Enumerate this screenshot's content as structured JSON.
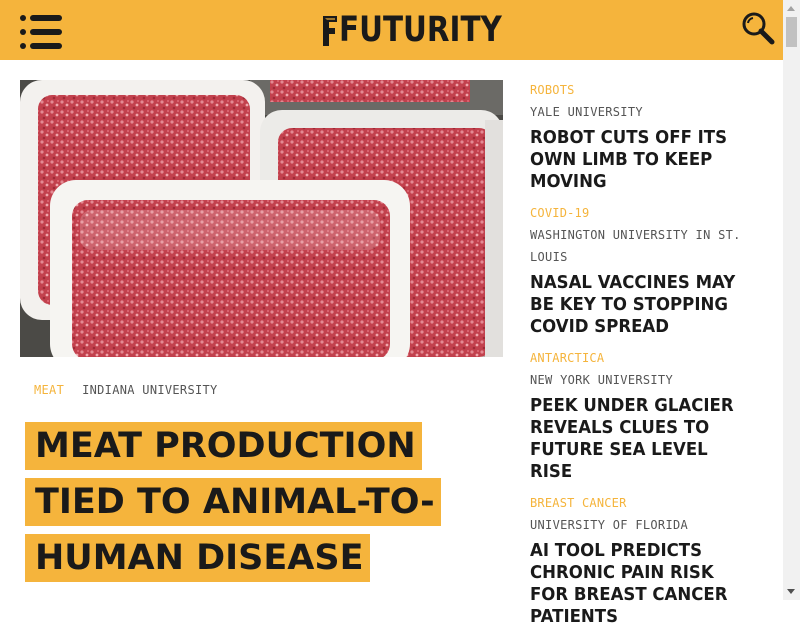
{
  "header": {
    "logo_text": "FUTURITY",
    "menu_icon": "hamburger-menu-icon",
    "search_icon": "search-icon",
    "brand_color": "#f5b43c"
  },
  "hero": {
    "image_subject": "meat-photo",
    "category": "MEAT",
    "university": "INDIANA UNIVERSITY",
    "title_lines": [
      "MEAT PRODUCTION",
      "TIED TO ANIMAL-TO-",
      "HUMAN DISEASE"
    ]
  },
  "sidebar": {
    "items": [
      {
        "category": "ROBOTS",
        "university": "YALE UNIVERSITY",
        "title": "ROBOT CUTS OFF ITS OWN LIMB TO KEEP MOVING"
      },
      {
        "category": "COVID-19",
        "university": "WASHINGTON UNIVERSITY IN ST. LOUIS",
        "title": "NASAL VACCINES MAY BE KEY TO STOPPING COVID SPREAD"
      },
      {
        "category": "ANTARCTICA",
        "university": "NEW YORK UNIVERSITY",
        "title": "PEEK UNDER GLACIER REVEALS CLUES TO FUTURE SEA LEVEL RISE"
      },
      {
        "category": "BREAST CANCER",
        "university": "UNIVERSITY OF FLORIDA",
        "title": "AI TOOL PREDICTS CHRONIC PAIN RISK FOR BREAST CANCER PATIENTS"
      }
    ]
  }
}
